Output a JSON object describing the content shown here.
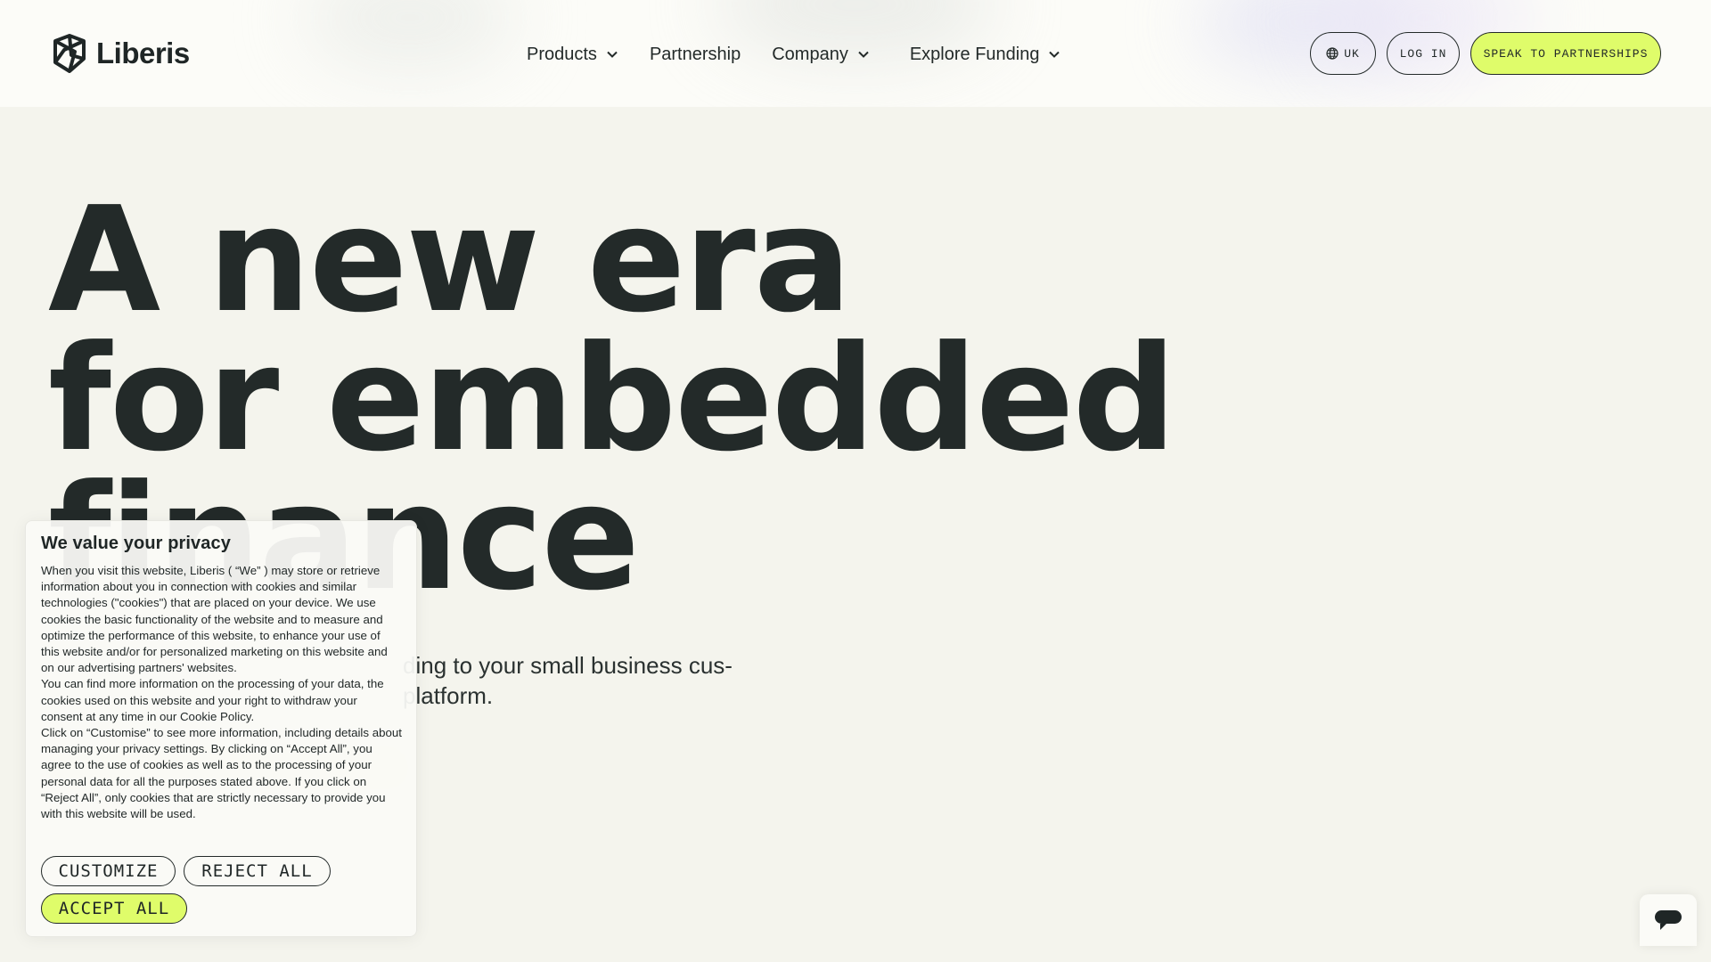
{
  "brand": {
    "name": "Liberis",
    "logo_icon": "liberis-logo-icon"
  },
  "nav": {
    "items": [
      {
        "label": "Products",
        "has_dropdown": true
      },
      {
        "label": "Partnership",
        "has_dropdown": false
      },
      {
        "label": "Company",
        "has_dropdown": true
      },
      {
        "label": "Explore Funding",
        "has_dropdown": true
      }
    ]
  },
  "header_buttons": {
    "region": "UK",
    "region_icon": "globe-icon",
    "login": "LOG IN",
    "speak": "SPEAK TO PARTNERSHIPS"
  },
  "hero": {
    "title_lines": [
      "A new era",
      "for embedded",
      "finance"
    ],
    "subtitle": "…ding to your small business cus- …platform."
  },
  "cookie": {
    "title": "We value your privacy",
    "paragraphs": [
      "When you visit this website, Liberis ( “We” ) may store or retrieve information about you in connection with cookies and similar technologies (\"cookies\") that are placed on your device. We use cookies the basic functionality of the website and to measure and optimize the performance of this website, to enhance your use of this website and/or for personalized marketing on this website and on our advertising partners' websites.",
      "You can find more information on the processing of your data, the cookies used on this website and your right to withdraw your consent at any time in our Cookie Policy.",
      "Click on “Customise” to see more information, including details about managing your privacy settings. By clicking on “Accept All”, you agree to the use of cookies as well as to the processing of your personal data for all the purposes stated above. If you click on “Reject All”, only cookies that are strictly necessary to provide you with this website will be used."
    ],
    "customize": "CUSTOMIZE",
    "reject": "REJECT ALL",
    "accept": "ACCEPT ALL"
  },
  "hero_visible_fragments": {
    "sub_line1": "ding to your small business cus-",
    "sub_line2": "platform."
  },
  "colors": {
    "accent": "#dffc6a",
    "text": "#232a29",
    "background": "#f4f4ed",
    "header_bg": "#fcfcf8"
  },
  "chat_widget": {
    "icon": "chat-bubble-icon"
  }
}
